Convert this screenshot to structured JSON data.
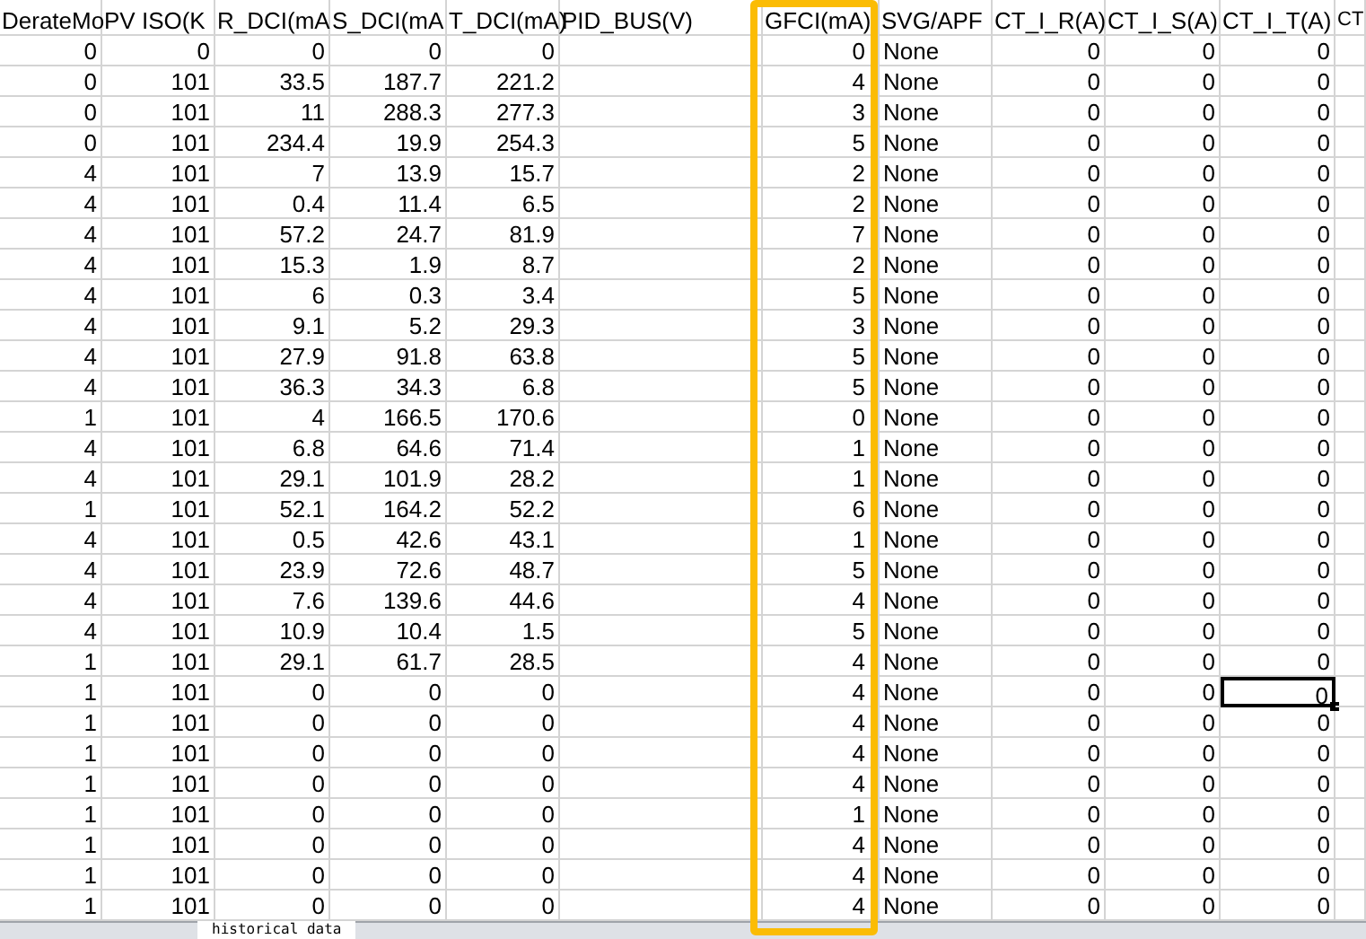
{
  "columns": [
    {
      "label": "DerateMo",
      "kind": "value",
      "highlighted": false,
      "selected": false
    },
    {
      "label": "PV ISO(K",
      "kind": "value",
      "highlighted": false,
      "selected": false
    },
    {
      "label": "R_DCI(mA",
      "kind": "value",
      "highlighted": false,
      "selected": false
    },
    {
      "label": "S_DCI(mA",
      "kind": "value",
      "highlighted": false,
      "selected": false
    },
    {
      "label": "T_DCI(mA)",
      "kind": "value",
      "highlighted": false,
      "selected": false
    },
    {
      "label": "PID_BUS(V)",
      "kind": "blank",
      "highlighted": false,
      "selected": false
    },
    {
      "label": "GFCI(mA)",
      "kind": "value",
      "highlighted": true,
      "selected": false
    },
    {
      "label": "SVG/APF",
      "kind": "text",
      "highlighted": false,
      "selected": false
    },
    {
      "label": "CT_I_R(A)",
      "kind": "value",
      "highlighted": false,
      "selected": false
    },
    {
      "label": "CT_I_S(A)",
      "kind": "value",
      "highlighted": false,
      "selected": false
    },
    {
      "label": "CT_I_T(A)",
      "kind": "value",
      "highlighted": false,
      "selected": true
    },
    {
      "label": "CT",
      "kind": "blank",
      "highlighted": false,
      "selected": false
    }
  ],
  "rows": [
    {
      "cells": [
        "0",
        "0",
        "0",
        "0",
        "0",
        "0",
        "None",
        "0",
        "0",
        "0"
      ],
      "selected": false
    },
    {
      "cells": [
        "0",
        "101",
        "33.5",
        "187.7",
        "221.2",
        "4",
        "None",
        "0",
        "0",
        "0"
      ],
      "selected": false
    },
    {
      "cells": [
        "0",
        "101",
        "11",
        "288.3",
        "277.3",
        "3",
        "None",
        "0",
        "0",
        "0"
      ],
      "selected": false
    },
    {
      "cells": [
        "0",
        "101",
        "234.4",
        "19.9",
        "254.3",
        "5",
        "None",
        "0",
        "0",
        "0"
      ],
      "selected": false
    },
    {
      "cells": [
        "4",
        "101",
        "7",
        "13.9",
        "15.7",
        "2",
        "None",
        "0",
        "0",
        "0"
      ],
      "selected": false
    },
    {
      "cells": [
        "4",
        "101",
        "0.4",
        "11.4",
        "6.5",
        "2",
        "None",
        "0",
        "0",
        "0"
      ],
      "selected": false
    },
    {
      "cells": [
        "4",
        "101",
        "57.2",
        "24.7",
        "81.9",
        "7",
        "None",
        "0",
        "0",
        "0"
      ],
      "selected": false
    },
    {
      "cells": [
        "4",
        "101",
        "15.3",
        "1.9",
        "8.7",
        "2",
        "None",
        "0",
        "0",
        "0"
      ],
      "selected": false
    },
    {
      "cells": [
        "4",
        "101",
        "6",
        "0.3",
        "3.4",
        "5",
        "None",
        "0",
        "0",
        "0"
      ],
      "selected": false
    },
    {
      "cells": [
        "4",
        "101",
        "9.1",
        "5.2",
        "29.3",
        "3",
        "None",
        "0",
        "0",
        "0"
      ],
      "selected": false
    },
    {
      "cells": [
        "4",
        "101",
        "27.9",
        "91.8",
        "63.8",
        "5",
        "None",
        "0",
        "0",
        "0"
      ],
      "selected": false
    },
    {
      "cells": [
        "4",
        "101",
        "36.3",
        "34.3",
        "6.8",
        "5",
        "None",
        "0",
        "0",
        "0"
      ],
      "selected": false
    },
    {
      "cells": [
        "1",
        "101",
        "4",
        "166.5",
        "170.6",
        "0",
        "None",
        "0",
        "0",
        "0"
      ],
      "selected": false
    },
    {
      "cells": [
        "4",
        "101",
        "6.8",
        "64.6",
        "71.4",
        "1",
        "None",
        "0",
        "0",
        "0"
      ],
      "selected": false
    },
    {
      "cells": [
        "4",
        "101",
        "29.1",
        "101.9",
        "28.2",
        "1",
        "None",
        "0",
        "0",
        "0"
      ],
      "selected": false
    },
    {
      "cells": [
        "1",
        "101",
        "52.1",
        "164.2",
        "52.2",
        "6",
        "None",
        "0",
        "0",
        "0"
      ],
      "selected": false
    },
    {
      "cells": [
        "4",
        "101",
        "0.5",
        "42.6",
        "43.1",
        "1",
        "None",
        "0",
        "0",
        "0"
      ],
      "selected": false
    },
    {
      "cells": [
        "4",
        "101",
        "23.9",
        "72.6",
        "48.7",
        "5",
        "None",
        "0",
        "0",
        "0"
      ],
      "selected": false
    },
    {
      "cells": [
        "4",
        "101",
        "7.6",
        "139.6",
        "44.6",
        "4",
        "None",
        "0",
        "0",
        "0"
      ],
      "selected": false
    },
    {
      "cells": [
        "4",
        "101",
        "10.9",
        "10.4",
        "1.5",
        "5",
        "None",
        "0",
        "0",
        "0"
      ],
      "selected": false
    },
    {
      "cells": [
        "1",
        "101",
        "29.1",
        "61.7",
        "28.5",
        "4",
        "None",
        "0",
        "0",
        "0"
      ],
      "selected": false
    },
    {
      "cells": [
        "1",
        "101",
        "0",
        "0",
        "0",
        "4",
        "None",
        "0",
        "0",
        "0"
      ],
      "selected": true
    },
    {
      "cells": [
        "1",
        "101",
        "0",
        "0",
        "0",
        "4",
        "None",
        "0",
        "0",
        "0"
      ],
      "selected": false
    },
    {
      "cells": [
        "1",
        "101",
        "0",
        "0",
        "0",
        "4",
        "None",
        "0",
        "0",
        "0"
      ],
      "selected": false
    },
    {
      "cells": [
        "1",
        "101",
        "0",
        "0",
        "0",
        "4",
        "None",
        "0",
        "0",
        "0"
      ],
      "selected": false
    },
    {
      "cells": [
        "1",
        "101",
        "0",
        "0",
        "0",
        "1",
        "None",
        "0",
        "0",
        "0"
      ],
      "selected": false
    },
    {
      "cells": [
        "1",
        "101",
        "0",
        "0",
        "0",
        "4",
        "None",
        "0",
        "0",
        "0"
      ],
      "selected": false
    },
    {
      "cells": [
        "1",
        "101",
        "0",
        "0",
        "0",
        "4",
        "None",
        "0",
        "0",
        "0"
      ],
      "selected": false
    },
    {
      "cells": [
        "1",
        "101",
        "0",
        "0",
        "0",
        "4",
        "None",
        "0",
        "0",
        "0"
      ],
      "selected": false
    }
  ],
  "sheet_tabs": [
    {
      "label": "historical data",
      "selected": true
    }
  ]
}
